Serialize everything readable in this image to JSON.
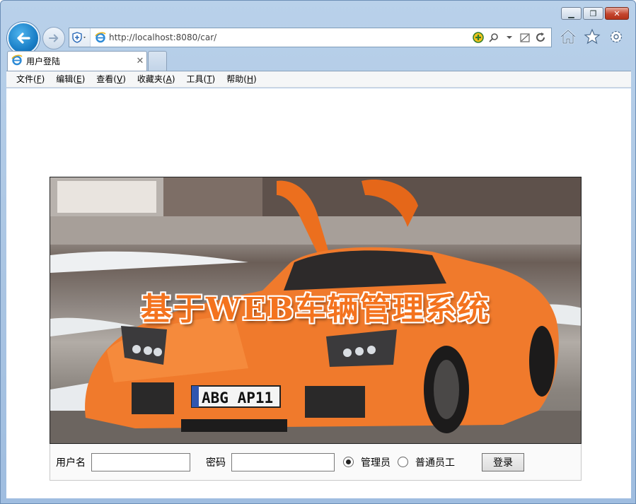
{
  "window": {
    "caption_buttons": [
      "minimize",
      "restore",
      "close"
    ]
  },
  "address_bar": {
    "url": "http://localhost:8080/car/"
  },
  "tab": {
    "title": "用户登陆"
  },
  "menu": [
    {
      "label": "文件",
      "key": "F"
    },
    {
      "label": "编辑",
      "key": "E"
    },
    {
      "label": "查看",
      "key": "V"
    },
    {
      "label": "收藏夹",
      "key": "A"
    },
    {
      "label": "工具",
      "key": "T"
    },
    {
      "label": "帮助",
      "key": "H"
    }
  ],
  "banner": {
    "title": "基于WEB车辆管理系统",
    "plate": "ABG AP11"
  },
  "login": {
    "username_label": "用户名",
    "username_value": "",
    "password_label": "密码",
    "password_value": "",
    "role_admin": "管理员",
    "role_staff": "普通员工",
    "selected_role": "管理员",
    "submit_label": "登录"
  },
  "colors": {
    "title_orange": "#f4731e",
    "car_orange": "#f07a2c",
    "browser_chrome": "#b9d1ea"
  }
}
